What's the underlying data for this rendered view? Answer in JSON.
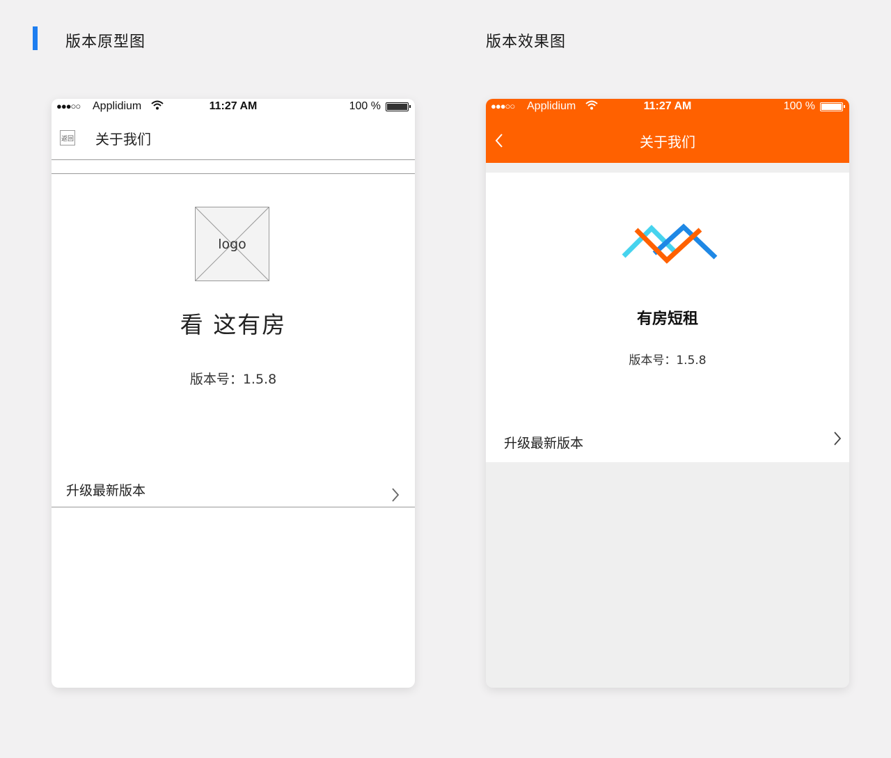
{
  "headings": {
    "prototype": "版本原型图",
    "final": "版本效果图"
  },
  "colors": {
    "accent_marker": "#1e7ef0",
    "header_orange": "#ff6100",
    "logo_cyan": "#46d3ee",
    "logo_blue": "#1f88e5",
    "logo_orange": "#ff6100"
  },
  "status_bar": {
    "signal": "●●●○○",
    "carrier": "Applidium",
    "wifi_icon": "wifi-icon",
    "time": "11:27 AM",
    "battery": "100 %"
  },
  "prototype": {
    "back_label": "返回",
    "nav_title": "关于我们",
    "logo_placeholder": "logo",
    "app_name": "看 这有房",
    "version": "版本号：1.5.8",
    "upgrade_label": "升级最新版本",
    "chevron": "›"
  },
  "final": {
    "back_icon": "‹",
    "nav_title": "关于我们",
    "app_name": "有房短租",
    "version": "版本号：1.5.8",
    "upgrade_label": "升级最新版本",
    "chevron": "›"
  }
}
